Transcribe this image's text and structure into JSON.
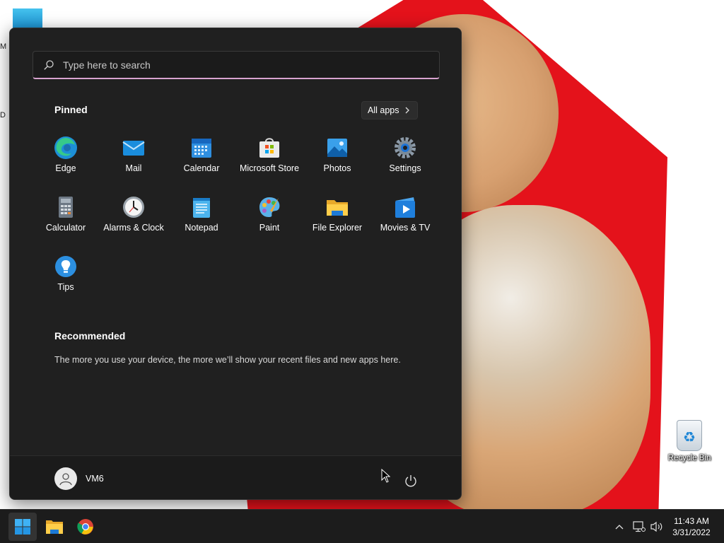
{
  "desktop": {
    "fragments": [
      "M",
      "D"
    ],
    "recycle_bin_label": "Recycle Bin"
  },
  "start_menu": {
    "search": {
      "placeholder": "Type here to search"
    },
    "pinned_title": "Pinned",
    "all_apps_label": "All apps",
    "pinned_apps": [
      {
        "label": "Edge",
        "icon": "edge-icon"
      },
      {
        "label": "Mail",
        "icon": "mail-icon"
      },
      {
        "label": "Calendar",
        "icon": "calendar-icon"
      },
      {
        "label": "Microsoft Store",
        "icon": "store-icon"
      },
      {
        "label": "Photos",
        "icon": "photos-icon"
      },
      {
        "label": "Settings",
        "icon": "settings-icon"
      },
      {
        "label": "Calculator",
        "icon": "calculator-icon"
      },
      {
        "label": "Alarms & Clock",
        "icon": "clock-icon"
      },
      {
        "label": "Notepad",
        "icon": "notepad-icon"
      },
      {
        "label": "Paint",
        "icon": "paint-icon"
      },
      {
        "label": "File Explorer",
        "icon": "folder-icon"
      },
      {
        "label": "Movies & TV",
        "icon": "movies-icon"
      },
      {
        "label": "Tips",
        "icon": "tips-icon"
      }
    ],
    "recommended_title": "Recommended",
    "recommended_text": "The more you use your device, the more we’ll show your recent files and new apps here.",
    "user_name": "VM6"
  },
  "taskbar": {
    "apps": [
      "start-icon",
      "file-explorer-icon",
      "chrome-icon"
    ],
    "time": "11:43 AM",
    "date": "3/31/2022"
  },
  "colors": {
    "menu_bg": "#202020",
    "search_accent": "#d8a3cf",
    "taskbar_bg": "#1c1c1c"
  }
}
